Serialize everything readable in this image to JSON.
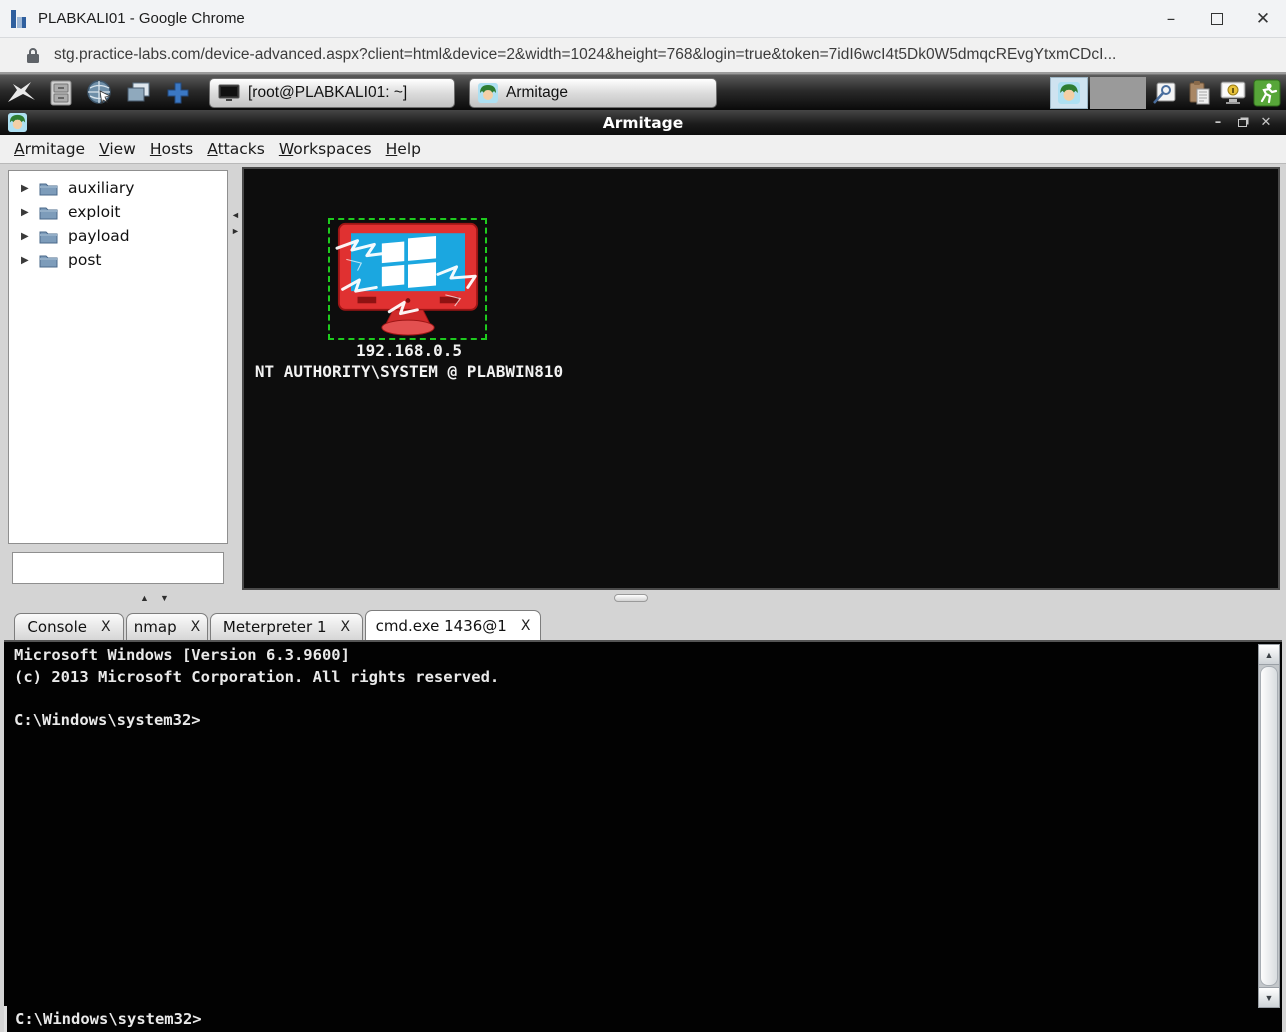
{
  "browser": {
    "title": "PLABKALI01 - Google Chrome",
    "url": "stg.practice-labs.com/device-advanced.aspx?client=html&device=2&width=1024&height=768&login=true&token=7idI6wcI4t5Dk0W5dmqcREvgYtxmCDcI...",
    "controls": {
      "minimize": "–",
      "close": "✕"
    }
  },
  "taskbar": {
    "task_buttons": [
      {
        "label": "[root@PLABKALI01: ~]"
      },
      {
        "label": "Armitage"
      }
    ],
    "launcher_icons": [
      "kali-logo-icon",
      "file-cabinet-icon",
      "web-browser-icon",
      "windows-icon",
      "add-workspace-icon"
    ],
    "tray_icons": [
      "armitage-avatar-icon",
      "workspace-switcher",
      "screenshot-icon",
      "clipboard-icon",
      "screen-lock-icon",
      "logout-icon"
    ]
  },
  "armitage": {
    "title": "Armitage",
    "controls": {
      "minimize": "–",
      "close": "✕"
    },
    "menu": [
      "Armitage",
      "View",
      "Hosts",
      "Attacks",
      "Workspaces",
      "Help"
    ],
    "module_tree": [
      "auxiliary",
      "exploit",
      "payload",
      "post"
    ],
    "module_search_value": "",
    "splitter_arrows": {
      "left": "◄",
      "right": "►",
      "up": "▲",
      "down": "▼"
    },
    "host": {
      "ip": "192.168.0.5",
      "session": "NT AUTHORITY\\SYSTEM @ PLABWIN810",
      "status": "compromised-windows-host"
    },
    "tabs": [
      {
        "label": "Console",
        "close": "X",
        "selected": false
      },
      {
        "label": "nmap",
        "close": "X",
        "selected": false
      },
      {
        "label": "Meterpreter 1",
        "close": "X",
        "selected": false
      },
      {
        "label": "cmd.exe 1436@1",
        "close": "X",
        "selected": true
      }
    ],
    "console": {
      "lines": {
        "l1": "Microsoft Windows [Version 6.3.9600]",
        "l2": "(c) 2013 Microsoft Corporation. All rights reserved.",
        "l3": "",
        "l4": "C:\\Windows\\system32>"
      },
      "prompt": "C:\\Windows\\system32>"
    }
  },
  "colors": {
    "selection_green": "#1ecb1e",
    "host_monitor_red": "#e03131",
    "host_screen_blue": "#1ba7e0",
    "console_bg": "#020202",
    "taskbar_dark": "#0a0a0a"
  }
}
